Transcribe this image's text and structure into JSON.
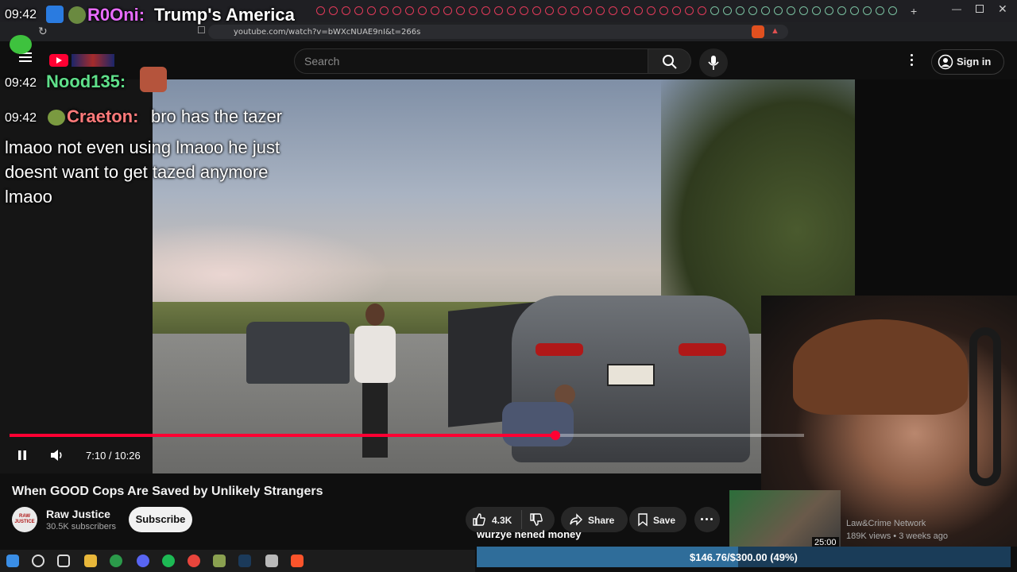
{
  "browser": {
    "url": "youtube.com/watch?v=bWXcNUAE9nI&t=266s"
  },
  "stream_title": {
    "time": "09:42",
    "user": "R0Oni:",
    "text": "Trump's America"
  },
  "chat": [
    {
      "time": "09:42",
      "user": "Nood135:",
      "text": ""
    },
    {
      "time": "09:42",
      "user": "Craeton:",
      "text": "bro has the tazer"
    }
  ],
  "chat_overflow": [
    "lmaoo not even using lmaoo he just",
    "doesnt want to get tazed anymore",
    "lmaoo"
  ],
  "youtube": {
    "search_placeholder": "Search",
    "signin_label": "Sign in"
  },
  "video": {
    "elapsed": "7:10",
    "duration": "10:26",
    "progress": 0.687,
    "time_label": "7:10 / 10:26"
  },
  "watch": {
    "title": "When GOOD Cops Are Saved by Unlikely Strangers",
    "channel": "Raw Justice",
    "subscribers": "30.5K subscribers",
    "subscribe_label": "Subscribe",
    "likes": "4.3K",
    "share_label": "Share",
    "save_label": "Save",
    "avatar_text": "RAW JUSTICE"
  },
  "recommended": {
    "duration": "25:00",
    "channel": "Law&Crime Network",
    "meta": "189K views • 3 weeks ago"
  },
  "donation": {
    "caption": "wurzye nened money",
    "label": "$146.76/$300.00 (49%)",
    "fraction": 0.49
  },
  "colors": {
    "accent_red": "#ff0033",
    "donation_fill": "#2f6d9a"
  }
}
